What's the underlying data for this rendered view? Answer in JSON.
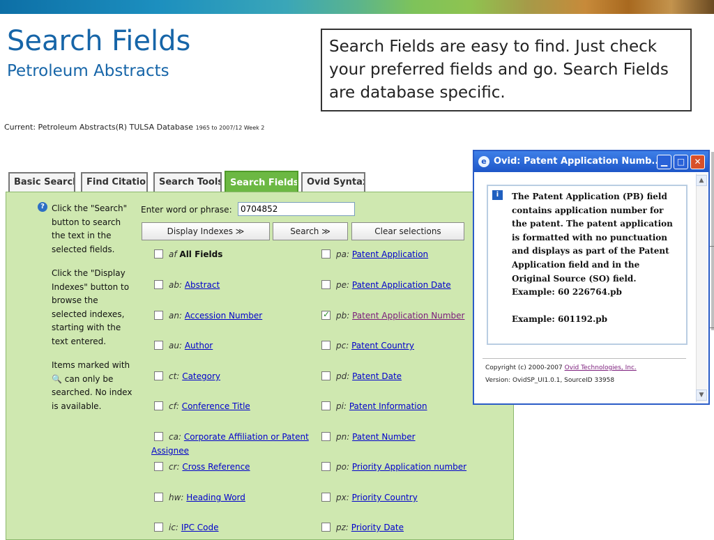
{
  "slide": {
    "title": "Search Fields",
    "subtitle": "Petroleum Abstracts",
    "callout": "Search Fields are easy to find. Just check your preferred fields and go. Search Fields are database specific."
  },
  "current": {
    "label": "Current: Petroleum Abstracts(R) TULSA Database",
    "range": "1965 to 2007/12 Week 2"
  },
  "tabs": [
    {
      "label": "Basic Search"
    },
    {
      "label": "Find Citation"
    },
    {
      "label": "Search Tools"
    },
    {
      "label": "Search Fields"
    },
    {
      "label": "Ovid Syntax"
    }
  ],
  "help": {
    "icon": "help-icon",
    "p1": "Click the \"Search\" button to search the text in the selected fields.",
    "p2": "Click the \"Display Indexes\" button to browse the selected indexes, starting with the text entered.",
    "p3a": "Items marked with",
    "p3b": "can only be searched. No index is available."
  },
  "search": {
    "label": "Enter word or phrase:",
    "value": "0704852",
    "display_indexes": "Display Indexes ≫",
    "search": "Search ≫",
    "clear": "Clear selections"
  },
  "fields_left": [
    {
      "code": "af",
      "name": "All Fields",
      "checked": false
    },
    {
      "code": "ab:",
      "name": "Abstract",
      "checked": false
    },
    {
      "code": "an:",
      "name": "Accession Number",
      "checked": false
    },
    {
      "code": "au:",
      "name": "Author",
      "checked": false
    },
    {
      "code": "ct:",
      "name": "Category",
      "checked": false
    },
    {
      "code": "cf:",
      "name": "Conference Title",
      "checked": false
    },
    {
      "code": "ca:",
      "name": "Corporate Affiliation or Patent",
      "name2": "Assignee",
      "checked": false
    },
    {
      "code": "cr:",
      "name": "Cross Reference",
      "checked": false
    },
    {
      "code": "hw:",
      "name": "Heading Word",
      "checked": false
    },
    {
      "code": "ic:",
      "name": "IPC Code",
      "checked": false
    }
  ],
  "fields_right": [
    {
      "code": "pa:",
      "name": "Patent Application",
      "checked": false
    },
    {
      "code": "pe:",
      "name": "Patent Application Date",
      "checked": false
    },
    {
      "code": "pb:",
      "name": "Patent Application Number",
      "checked": true
    },
    {
      "code": "pc:",
      "name": "Patent Country",
      "checked": false
    },
    {
      "code": "pd:",
      "name": "Patent Date",
      "checked": false
    },
    {
      "code": "pi:",
      "name": "Patent Information",
      "checked": false
    },
    {
      "code": "pn:",
      "name": "Patent Number",
      "checked": false
    },
    {
      "code": "po:",
      "name": "Priority Application number",
      "checked": false
    },
    {
      "code": "px:",
      "name": "Priority Country",
      "checked": false
    },
    {
      "code": "pz:",
      "name": "Priority Date",
      "checked": false
    }
  ],
  "popup": {
    "title": "Ovid: Patent Application Numb...",
    "lines": [
      "The Patent Application (PB) field",
      "contains application number for",
      "the patent. The patent application",
      "is formatted with no punctuation",
      "and displays as part of the Patent",
      "Application field and in the",
      "Original Source (SO) field.",
      "Example: 60 226764.pb",
      "",
      "Example: 601192.pb"
    ],
    "copyright_prefix": "Copyright (c) 2000-2007",
    "copyright_link": "Ovid Technologies, Inc.",
    "version": "Version: OvidSP_UI1.0.1, SourceID 33958"
  },
  "colors": {
    "title": "#1665a8",
    "panel": "#cfe8b0",
    "active_tab": "#6cb843",
    "link": "#0000cc",
    "visited_link": "#7a1a7a"
  }
}
